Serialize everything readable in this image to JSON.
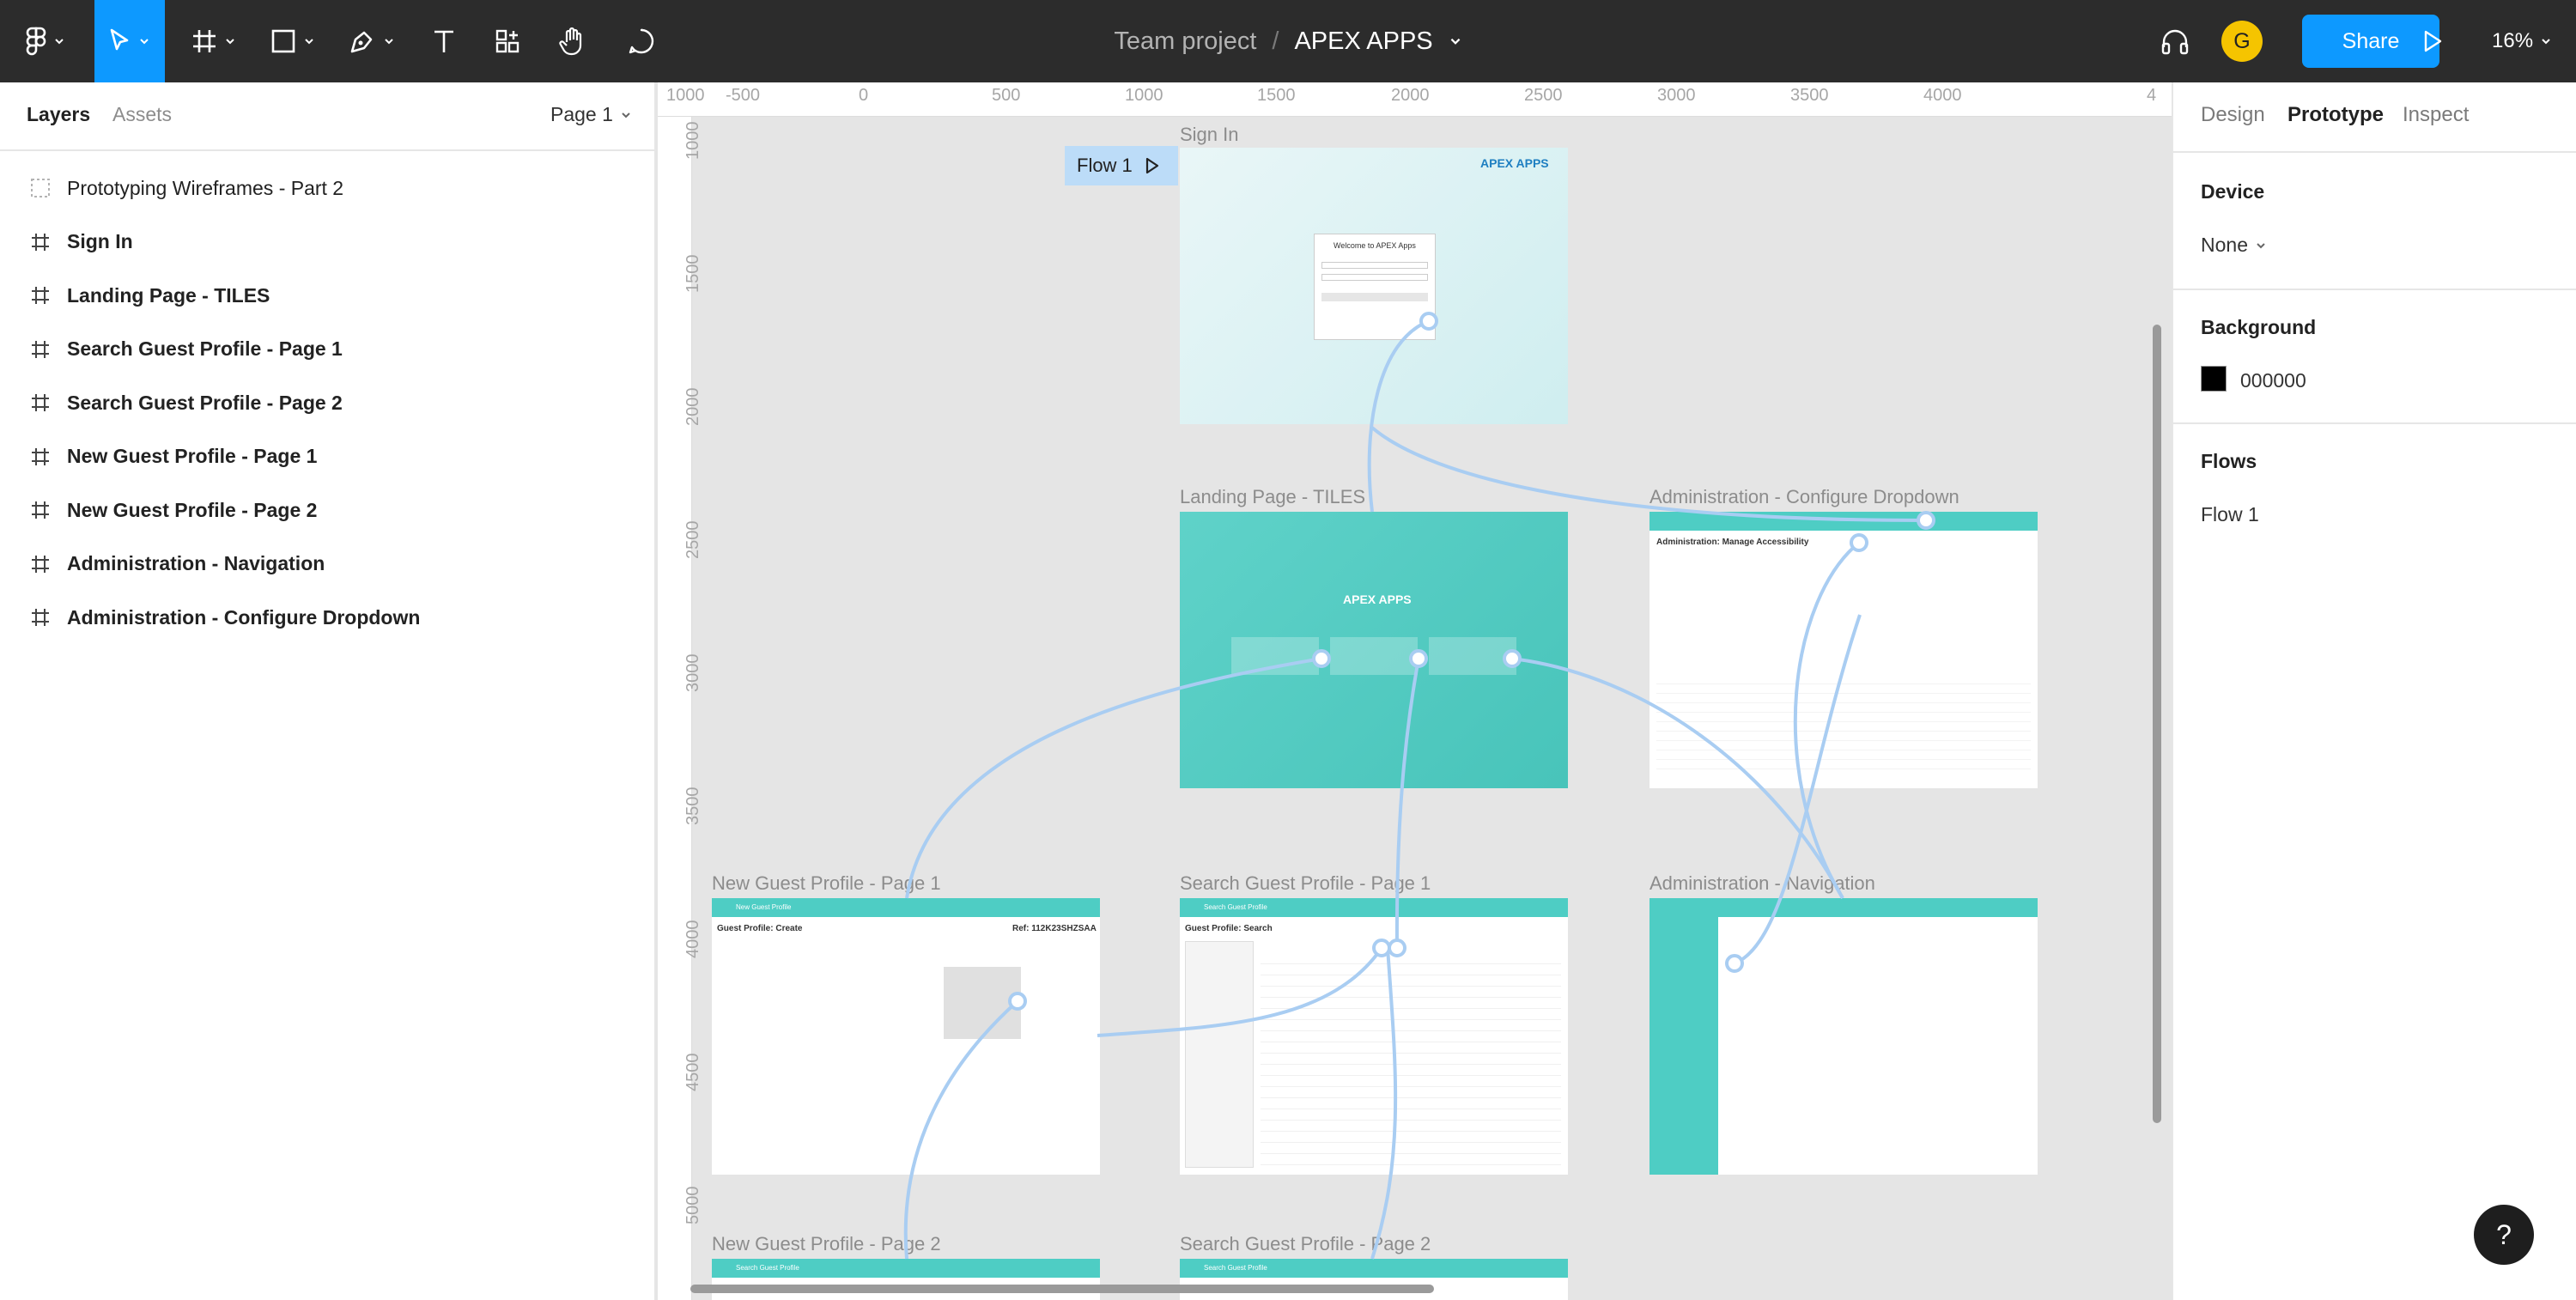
{
  "app": {
    "team": "Team project",
    "separator": "/",
    "file_name": "APEX APPS",
    "user_initial": "G",
    "share_label": "Share",
    "zoom": "16%"
  },
  "toolbar": {
    "tools": [
      "main-menu-icon",
      "move-icon",
      "frame-icon",
      "rectangle-icon",
      "pen-icon",
      "text-icon",
      "resources-icon",
      "hand-icon",
      "comment-icon"
    ],
    "accent": "#0d99ff"
  },
  "left_panel": {
    "tabs": {
      "layers": "Layers",
      "assets": "Assets"
    },
    "page": "Page 1",
    "layers": [
      {
        "label": "Prototyping Wireframes - Part 2",
        "icon": "section-icon",
        "bold": false
      },
      {
        "label": "Sign In",
        "icon": "frame-icon",
        "bold": true
      },
      {
        "label": "Landing Page - TILES",
        "icon": "frame-icon",
        "bold": true
      },
      {
        "label": "Search Guest Profile - Page 1",
        "icon": "frame-icon",
        "bold": true
      },
      {
        "label": "Search Guest Profile - Page 2",
        "icon": "frame-icon",
        "bold": true
      },
      {
        "label": "New Guest Profile - Page 1",
        "icon": "frame-icon",
        "bold": true
      },
      {
        "label": "New Guest Profile - Page 2",
        "icon": "frame-icon",
        "bold": true
      },
      {
        "label": "Administration - Navigation",
        "icon": "frame-icon",
        "bold": true
      },
      {
        "label": "Administration - Configure Dropdown",
        "icon": "frame-icon",
        "bold": true
      }
    ]
  },
  "right_panel": {
    "tabs": {
      "design": "Design",
      "prototype": "Prototype",
      "inspect": "Inspect"
    },
    "device_heading": "Device",
    "device_value": "None",
    "background_heading": "Background",
    "background_value": "000000",
    "flows_heading": "Flows",
    "flow_item": "Flow 1"
  },
  "canvas": {
    "ruler_x": [
      "1000",
      "-500",
      "0",
      "500",
      "1000",
      "1500",
      "2000",
      "2500",
      "3000",
      "3500",
      "4000",
      "4"
    ],
    "ruler_y": [
      "1000",
      "1500",
      "2000",
      "2500",
      "3000",
      "3500",
      "4000",
      "4500",
      "5000"
    ],
    "flow_badge": "Flow 1",
    "frames": {
      "sign_in": "Sign In",
      "landing": "Landing Page - TILES",
      "admin_dropdown": "Administration - Configure Dropdown",
      "new_guest_1": "New Guest Profile - Page 1",
      "search_guest_1": "Search Guest Profile - Page 1",
      "admin_nav": "Administration - Navigation",
      "new_guest_2": "New Guest Profile - Page 2",
      "search_guest_2": "Search Guest Profile - Page 2"
    },
    "mini": {
      "welcome": "Welcome to APEX Apps",
      "apex_logo": "APEX APPS",
      "admin_title": "Administration: Manage Accessibility",
      "create_title": "Guest Profile: Create",
      "create_ref": "Ref: 112K23SHZSAA",
      "search_title": "Guest Profile: Search",
      "new_profile_bar": "New Guest Profile",
      "search_profile_bar": "Search Guest Profile"
    },
    "connector_color": "#a9cdf2",
    "teal": "#4ecdc4"
  },
  "help_label": "?"
}
